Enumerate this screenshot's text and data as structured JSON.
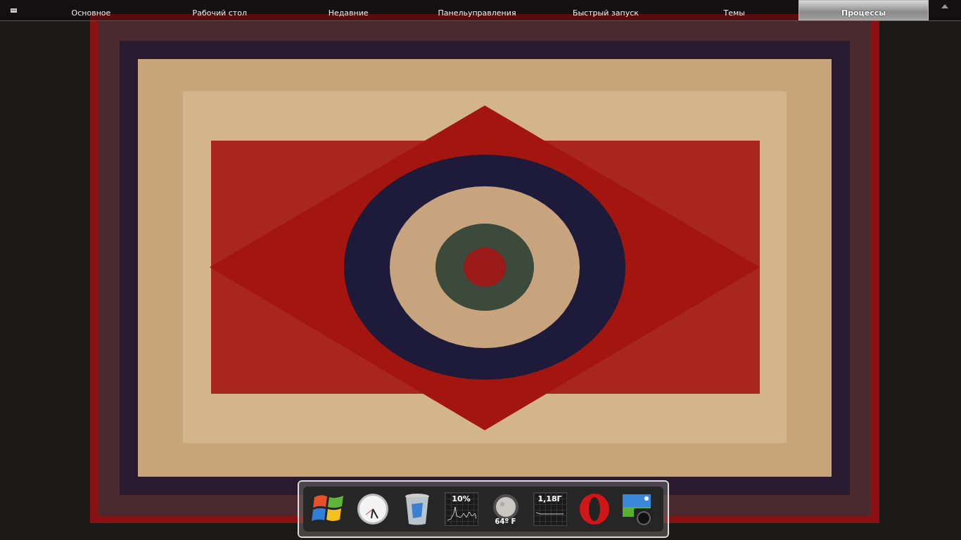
{
  "top_bar": {
    "tabs": [
      {
        "label": "Основное",
        "selected": false
      },
      {
        "label": "Рабочий стол",
        "selected": false
      },
      {
        "label": "Недавние",
        "selected": false
      },
      {
        "label": "Панельуправления",
        "selected": false
      },
      {
        "label": "Быстрый запуск",
        "selected": false
      },
      {
        "label": "Темы",
        "selected": false
      },
      {
        "label": "Процессы",
        "selected": true
      }
    ]
  },
  "dock": {
    "items": [
      {
        "kind": "start"
      },
      {
        "kind": "clock"
      },
      {
        "kind": "trash"
      },
      {
        "kind": "cpu",
        "reading": "10%"
      },
      {
        "kind": "weather",
        "reading": "64º F"
      },
      {
        "kind": "memory",
        "reading": "1,18Г"
      },
      {
        "kind": "browser"
      },
      {
        "kind": "photos"
      }
    ]
  }
}
